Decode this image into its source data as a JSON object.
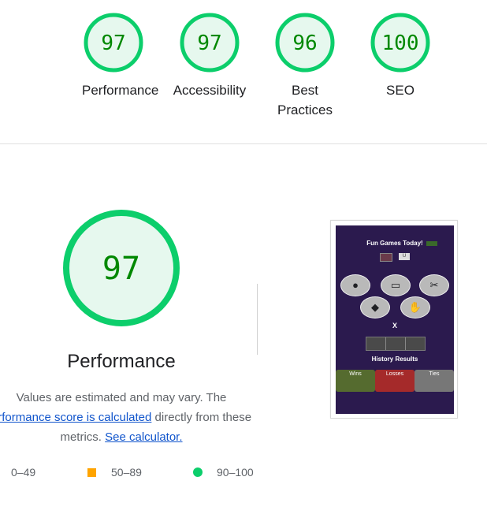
{
  "summary": {
    "gauges": [
      {
        "score": "97",
        "label": "Performance"
      },
      {
        "score": "97",
        "label": "Accessibility"
      },
      {
        "score": "96",
        "label": "Best Practices",
        "line1": "Best",
        "line2": "Practices"
      },
      {
        "score": "100",
        "label": "SEO"
      }
    ]
  },
  "performance": {
    "score": "97",
    "title": "Performance",
    "desc_before": "Values are estimated and may vary. The",
    "desc_link": "erformance score is calculated",
    "desc_after": " directly from these",
    "desc_line3_before": "metrics. ",
    "calc_link": "See calculator."
  },
  "legend": {
    "fail": "0–49",
    "average": "50–89",
    "pass": "90–100"
  },
  "thumbnail": {
    "title": "Fun Games Today!",
    "x_text": "X",
    "history": "History Results",
    "wins": "Wins",
    "losses": "Losses",
    "ties": "Ties"
  },
  "colors": {
    "pass_green": "#0cce6b",
    "pass_fill": "#e6f8ee",
    "score_text": "#008800",
    "average_orange": "#ffa400",
    "link_blue": "#1155cc"
  }
}
